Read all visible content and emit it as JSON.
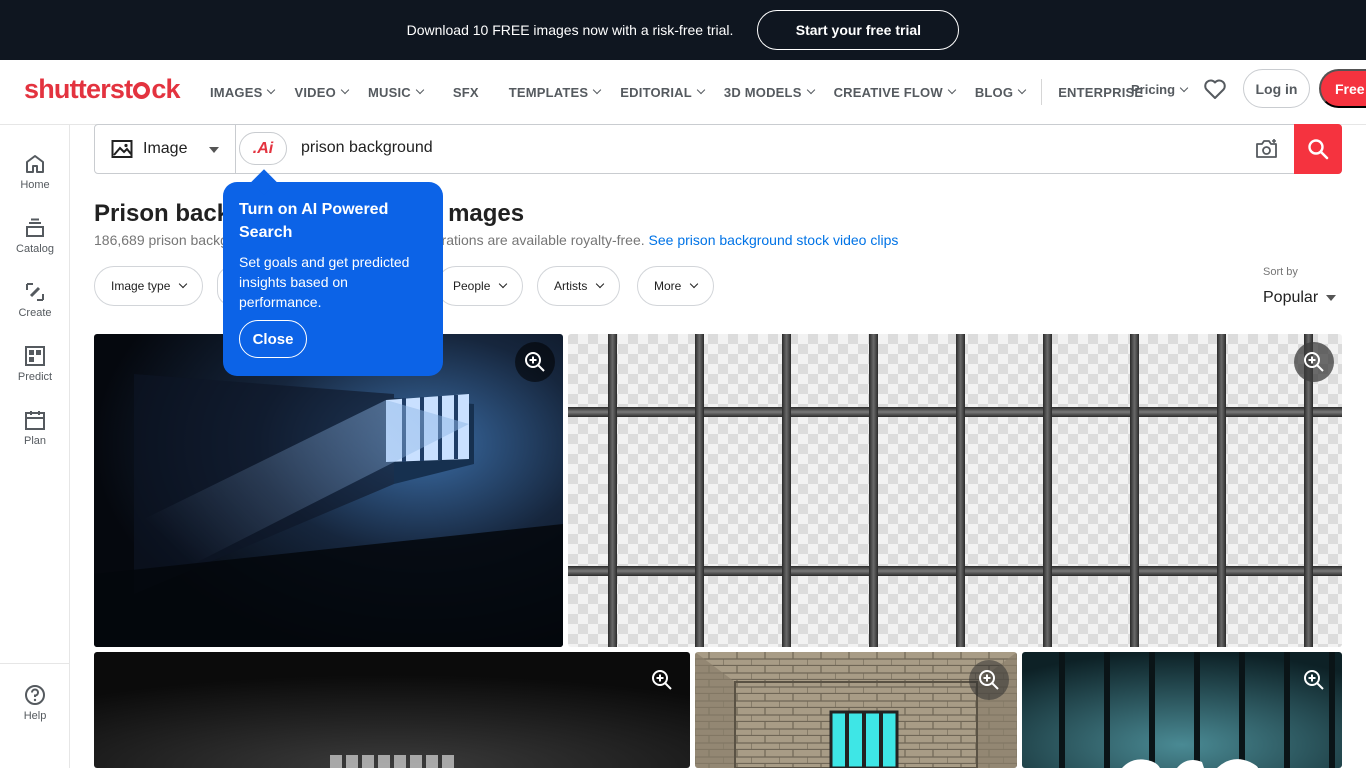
{
  "promo": {
    "text": "Download 10 FREE images now with a risk-free trial.",
    "button": "Start your free trial"
  },
  "nav": {
    "logo": "shutterstock",
    "items": [
      "IMAGES",
      "VIDEO",
      "MUSIC",
      "SFX",
      "TEMPLATES",
      "EDITORIAL",
      "3D MODELS",
      "CREATIVE FLOW",
      "BLOG"
    ],
    "enterprise": "ENTERPRISE",
    "pricing": "Pricing",
    "login": "Log in",
    "free": "Free t"
  },
  "sidebar": {
    "items": [
      "Home",
      "Catalog",
      "Create",
      "Predict",
      "Plan"
    ],
    "help": "Help"
  },
  "search": {
    "type": "Image",
    "ai_label": ".Ai",
    "query": "prison background"
  },
  "results": {
    "title_start": "Prison back",
    "title_end": "mages",
    "subtitle_start": "186,689 prison backg",
    "subtitle_end": "ustrations are available royalty-free.",
    "video_link": "See prison background stock video clips"
  },
  "filters": [
    "Image type",
    "People",
    "Artists",
    "More"
  ],
  "sort": {
    "label": "Sort by",
    "value": "Popular"
  },
  "popup": {
    "title": "Turn on AI Powered Search",
    "body": "Set goals and get predicted insights based on performance.",
    "close": "Close"
  },
  "colors": {
    "brand_red": "#f5333f",
    "promo_bg": "#0f1620",
    "popup_blue": "#0c63e7",
    "link_blue": "#0073e6"
  }
}
